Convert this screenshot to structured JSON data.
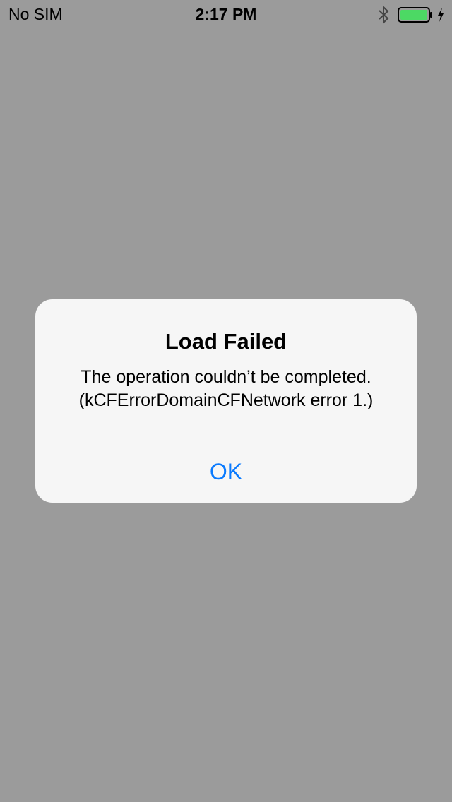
{
  "status_bar": {
    "carrier": "No SIM",
    "time": "2:17 PM",
    "battery_color": "#4cd964"
  },
  "alert": {
    "title": "Load Failed",
    "message_line1": "The operation couldn’t be completed.",
    "message_line2": "(kCFErrorDomainCFNetwork error 1.)",
    "ok_label": "OK",
    "button_color": "#0a7afe"
  }
}
